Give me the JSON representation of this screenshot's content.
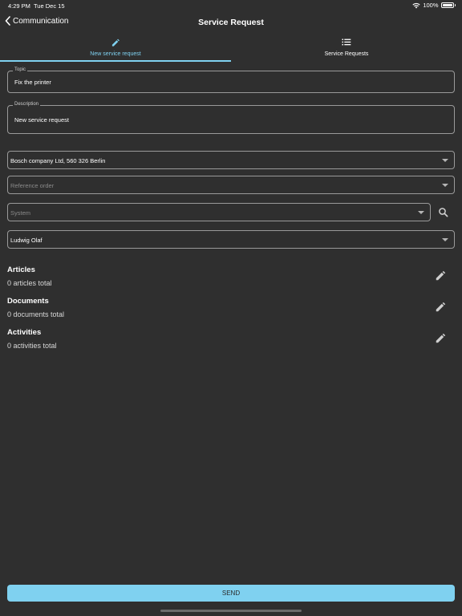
{
  "status_bar": {
    "time": "4:29 PM",
    "date": "Tue Dec 15",
    "battery": "100%"
  },
  "nav": {
    "back_label": "Communication",
    "title": "Service Request"
  },
  "tabs": [
    {
      "label": "New service request",
      "icon": "pencil-icon",
      "active": true
    },
    {
      "label": "Service Requests",
      "icon": "list-icon",
      "active": false
    }
  ],
  "form": {
    "topic": {
      "label": "Topic",
      "value": "Fix the printer"
    },
    "description": {
      "label": "Description",
      "value": "New service request"
    },
    "company": {
      "value": "Bosch company Ltd, 560 326 Berlin"
    },
    "reference_order": {
      "placeholder": "Reference order"
    },
    "system": {
      "placeholder": "System"
    },
    "contact": {
      "value": "Ludwig Olaf"
    }
  },
  "sections": [
    {
      "title": "Articles",
      "count": "0 articles total"
    },
    {
      "title": "Documents",
      "count": "0 documents total"
    },
    {
      "title": "Activities",
      "count": "0 activities total"
    }
  ],
  "send_label": "SEND",
  "colors": {
    "accent": "#7fd1f0",
    "background": "#2f2f2f",
    "border": "#9a9a9a"
  }
}
